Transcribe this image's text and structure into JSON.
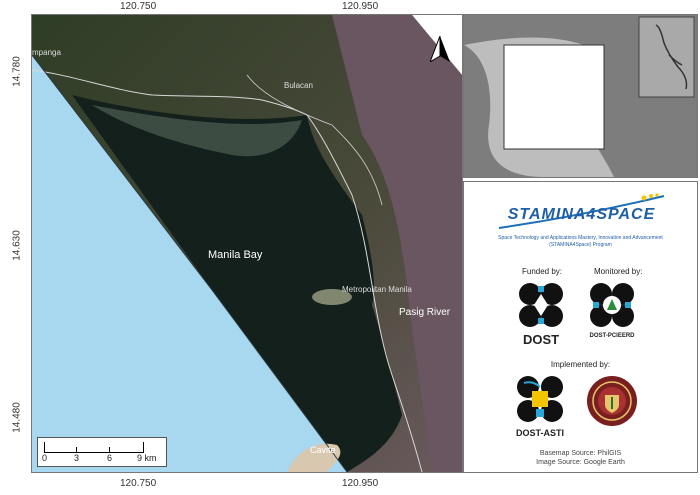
{
  "coords": {
    "x_top": [
      "120.750",
      "120.950"
    ],
    "x_bottom": [
      "120.750",
      "120.950"
    ],
    "y_left": [
      "14.780",
      "14.630",
      "14.480"
    ]
  },
  "map": {
    "place_labels": {
      "pampanga": "mpanga",
      "bulacan": "Bulacan",
      "manila_bay": "Manila Bay",
      "metro_manila": "Metropolitan Manila",
      "pasig_river": "Pasig River",
      "cavite": "Cavite"
    },
    "north": "N",
    "scale": {
      "ticks": [
        "0",
        "3",
        "6",
        "9 km"
      ]
    },
    "colors": {
      "sea": "#a8d8f0",
      "water_dark": "#14201c",
      "land": "#3a4a2f"
    }
  },
  "credits": {
    "logo_title": "STAMINA4SPACE",
    "logo_sub1": "Space Technology and Applications Mastery, Innovation and Advancement",
    "logo_sub2": "(STAMINA4Space) Program",
    "funded_by": "Funded by:",
    "monitored_by": "Monitored by:",
    "dost": "DOST",
    "dost_pcieerd": "DOST-PCIEERD",
    "implemented_by": "Implemented by:",
    "dost_asti": "DOST-ASTI",
    "basemap_source": "Basemap Source: PhilGIS",
    "image_source": "Image Source: Google Earth"
  }
}
